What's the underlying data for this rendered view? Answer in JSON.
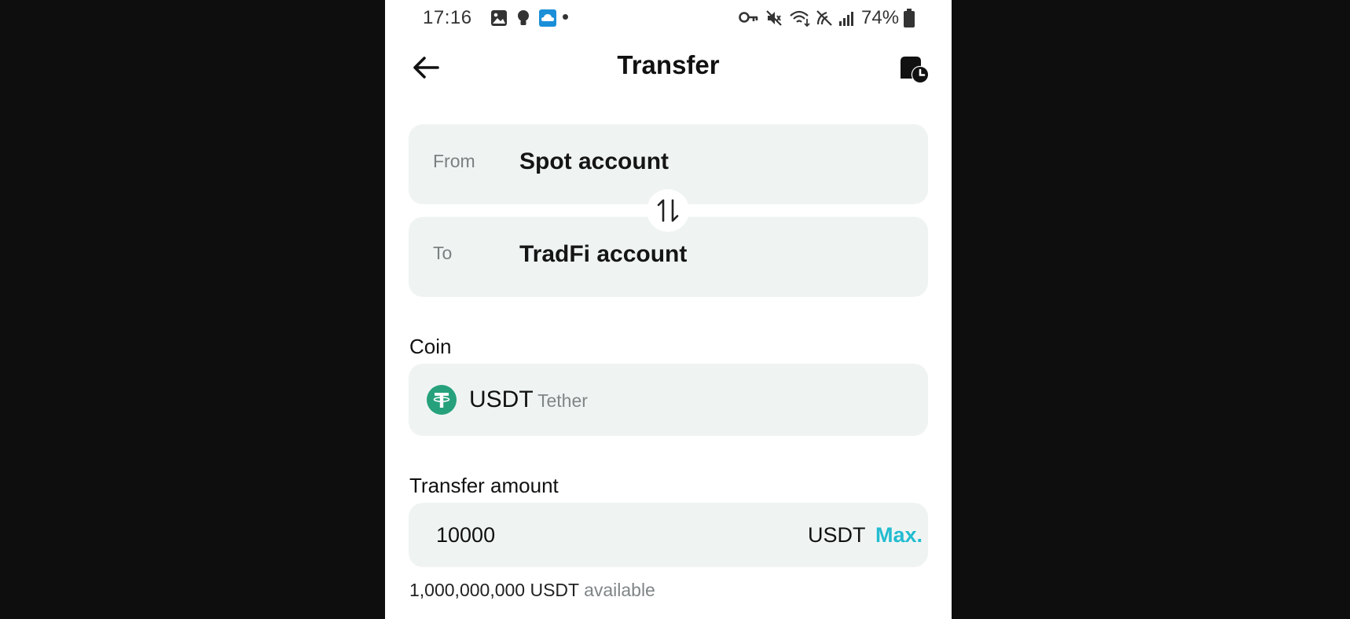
{
  "status_bar": {
    "time": "17:16",
    "battery_percent": "74%",
    "icons": [
      "gallery-icon",
      "bulb-icon",
      "cloud-app-icon",
      "dot-icon",
      "key-icon",
      "mute-icon",
      "wifi-icon",
      "hotspot-icon",
      "signal-icon",
      "battery-icon"
    ]
  },
  "header": {
    "title": "Transfer",
    "back_icon": "arrow-left-icon",
    "history_icon": "history-icon"
  },
  "transfer": {
    "from_label": "From",
    "from_value": "Spot account",
    "to_label": "To",
    "to_value": "TradFi account",
    "swap_icon": "swap-vertical-icon"
  },
  "coin": {
    "label": "Coin",
    "symbol": "USDT",
    "name": "Tether",
    "logo_color": "#26a17b"
  },
  "amount": {
    "label": "Transfer amount",
    "value": "10000",
    "unit": "USDT",
    "max_label": "Max.",
    "available_value": "1,000,000,000 USDT",
    "available_suffix": "available"
  },
  "colors": {
    "accent": "#22bcd0",
    "card_background": "#eff4f3"
  }
}
